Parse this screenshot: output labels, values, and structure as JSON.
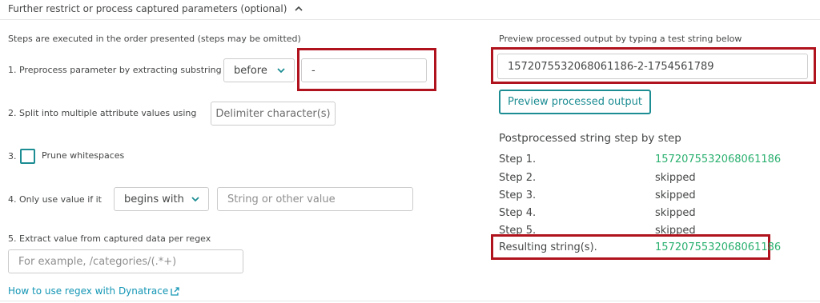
{
  "section": {
    "title": "Further restrict or process captured parameters (optional)",
    "chevron_icon": "chevron-up-icon"
  },
  "left": {
    "intro": "Steps are executed in the order presented (steps may be omitted)",
    "step1": {
      "label": "1. Preprocess parameter by extracting substring",
      "dropdown_value": "before",
      "input_value": "-"
    },
    "step2": {
      "label": "2. Split into multiple attribute values using",
      "button_label": "Delimiter character(s)"
    },
    "step3": {
      "number": "3.",
      "label": "Prune whitespaces",
      "checked": false
    },
    "step4": {
      "label": "4. Only use value if it",
      "dropdown_value": "begins with",
      "input_placeholder": "String or other value"
    },
    "step5": {
      "label": "5. Extract value from captured data per regex",
      "input_placeholder": "For example, /categories/(.*+)"
    },
    "help_link": {
      "label": "How to use regex with Dynatrace",
      "icon": "external-link-icon"
    }
  },
  "right": {
    "preview_label": "Preview processed output by typing a test string below",
    "test_string": "1572075532068061186-2-1754561789",
    "preview_button": "Preview processed output",
    "steps_title": "Postprocessed string step by step",
    "steps": [
      {
        "label": "Step 1.",
        "value": "1572075532068061186",
        "status": "result"
      },
      {
        "label": "Step 2.",
        "value": "skipped",
        "status": "skipped"
      },
      {
        "label": "Step 3.",
        "value": "skipped",
        "status": "skipped"
      },
      {
        "label": "Step 4.",
        "value": "skipped",
        "status": "skipped"
      },
      {
        "label": "Step 5.",
        "value": "skipped",
        "status": "skipped"
      }
    ],
    "result": {
      "label": "Resulting string(s).",
      "value": "1572075532068061186"
    }
  },
  "colors": {
    "accent": "#1c8d93",
    "success": "#2ab06f",
    "highlight": "#b0131d",
    "link": "#1496b5"
  }
}
